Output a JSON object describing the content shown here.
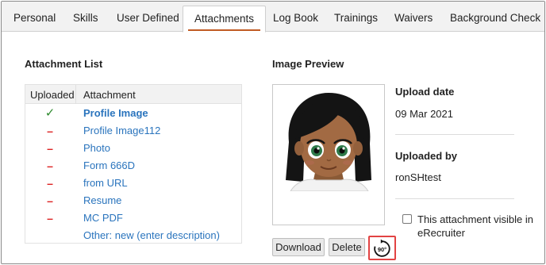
{
  "tabs": [
    {
      "label": "Personal",
      "active": false
    },
    {
      "label": "Skills",
      "active": false
    },
    {
      "label": "User Defined",
      "active": false
    },
    {
      "label": "Attachments",
      "active": true
    },
    {
      "label": "Log Book",
      "active": false
    },
    {
      "label": "Trainings",
      "active": false
    },
    {
      "label": "Waivers",
      "active": false
    },
    {
      "label": "Background Check",
      "active": false
    }
  ],
  "attachment_list": {
    "title": "Attachment List",
    "headers": {
      "uploaded": "Uploaded",
      "attachment": "Attachment"
    },
    "rows": [
      {
        "status": "uploaded",
        "mark": "✓",
        "name": "Profile Image",
        "selected": true
      },
      {
        "status": "missing",
        "mark": "–",
        "name": "Profile Image112",
        "selected": false
      },
      {
        "status": "missing",
        "mark": "–",
        "name": "Photo",
        "selected": false
      },
      {
        "status": "missing",
        "mark": "–",
        "name": "Form 666D",
        "selected": false
      },
      {
        "status": "missing",
        "mark": "–",
        "name": "from URL",
        "selected": false
      },
      {
        "status": "missing",
        "mark": "–",
        "name": "Resume",
        "selected": false
      },
      {
        "status": "missing",
        "mark": "–",
        "name": "MC PDF",
        "selected": false
      },
      {
        "status": "none",
        "mark": "",
        "name": "Other: new (enter description)",
        "selected": false
      }
    ]
  },
  "preview": {
    "title": "Image Preview",
    "download_label": "Download",
    "delete_label": "Delete",
    "rotate_label": "90°",
    "rotate_icon": "rotate-90-icon"
  },
  "info": {
    "upload_date_label": "Upload date",
    "upload_date_value": "09 Mar 2021",
    "uploaded_by_label": "Uploaded by",
    "uploaded_by_value": "ronSHtest",
    "visible_checkbox_label": "This attachment visible in eRecruiter",
    "visible_checked": false
  },
  "colors": {
    "link": "#2a74bd",
    "check": "#2e8a2e",
    "dash": "#dd2222",
    "active_tab_underline": "#c15b24",
    "highlight_border": "#e24343"
  }
}
